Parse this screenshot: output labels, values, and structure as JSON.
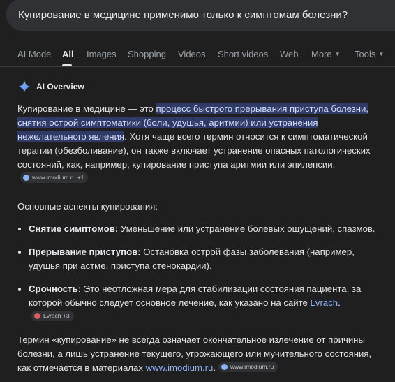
{
  "search": {
    "query": "Купирование в медицине применимо только к симптомам болезни?"
  },
  "tabs": [
    {
      "label": "AI Mode"
    },
    {
      "label": "All"
    },
    {
      "label": "Images"
    },
    {
      "label": "Shopping"
    },
    {
      "label": "Videos"
    },
    {
      "label": "Short videos"
    },
    {
      "label": "Web"
    },
    {
      "label": "More"
    },
    {
      "label": "Tools"
    }
  ],
  "overview": {
    "title": "AI Overview",
    "para1_start": "Купирование в медицине — это ",
    "para1_highlight": "процесс быстрого прерывания приступа болезни, снятия острой симптоматики (боли, удушья, аритмии) или устранения нежелательного явления",
    "para1_end": ". Хотя чаще всего термин относится к симптоматической терапии (обезболивание), он также включает устранение опасных патологических состояний, как, например, купирование приступа аритмии или эпилепсии.",
    "para1_chip": "www.imodium.ru +1",
    "aspects_intro": "Основные аспекты купирования:",
    "bullets": [
      {
        "term": "Снятие симптомов:",
        "text": " Уменьшение или устранение болевых ощущений, спазмов."
      },
      {
        "term": "Прерывание приступов:",
        "text": " Остановка острой фазы заболевания (например, удушья при астме, приступа стенокардии)."
      },
      {
        "term": "Срочность:",
        "text": " Это неотложная мера для стабилизации состояния пациента, за которой обычно следует основное лечение, как указано на сайте ",
        "link": "Lvrach",
        "after_link": ".",
        "chip": "Lvrach +3"
      }
    ],
    "final_text": "Термин «купирование» не всегда означает окончательное излечение от причины болезни, а лишь устранение текущего, угрожающего или мучительного состояния, как отмечается в материалах ",
    "final_link": "www.imodium.ru",
    "final_after": ".",
    "final_chip": "www.imodium.ru"
  },
  "colors": {
    "highlight_bg": "#303a66",
    "link": "#8ab4f8",
    "background": "#1f1f1f"
  }
}
